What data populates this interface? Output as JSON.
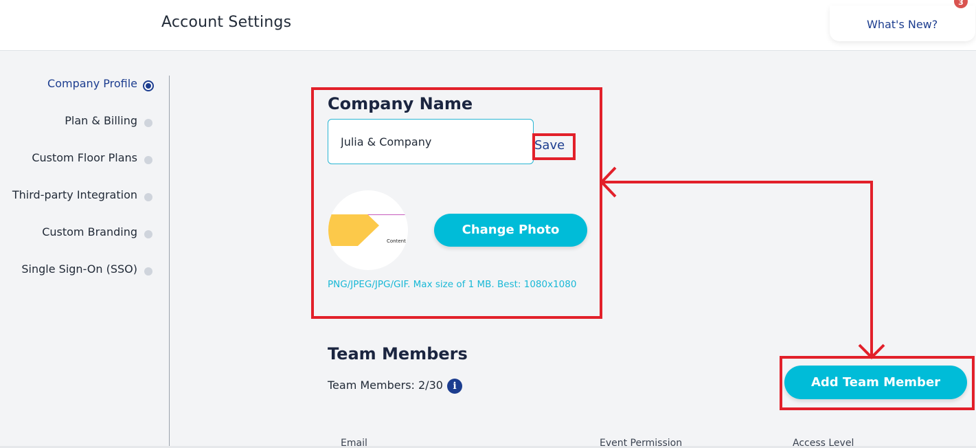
{
  "header": {
    "title": "Account Settings",
    "whats_new": "What's New?",
    "badge": "3"
  },
  "sidebar": {
    "items": [
      {
        "label": "Company Profile",
        "active": true
      },
      {
        "label": "Plan & Billing",
        "active": false
      },
      {
        "label": "Custom Floor Plans",
        "active": false
      },
      {
        "label": "Third-party Integration",
        "active": false
      },
      {
        "label": "Custom Branding",
        "active": false
      },
      {
        "label": "Single Sign-On (SSO)",
        "active": false
      }
    ]
  },
  "company": {
    "heading": "Company Name",
    "name_value": "Julia & Company",
    "save_label": "Save",
    "photo_preview_text": "Content",
    "change_photo_label": "Change Photo",
    "hint": "PNG/JPEG/JPG/GIF. Max size of 1 MB. Best: 1080x1080"
  },
  "team": {
    "heading": "Team Members",
    "count_label": "Team Members: 2/30",
    "info_icon": "i",
    "add_label": "Add Team Member",
    "columns": [
      "Email",
      "Event Permission",
      "Access Level"
    ]
  },
  "colors": {
    "accent": "#00bcd8",
    "brand": "#1c3d8f",
    "annotation": "#e2202a"
  }
}
